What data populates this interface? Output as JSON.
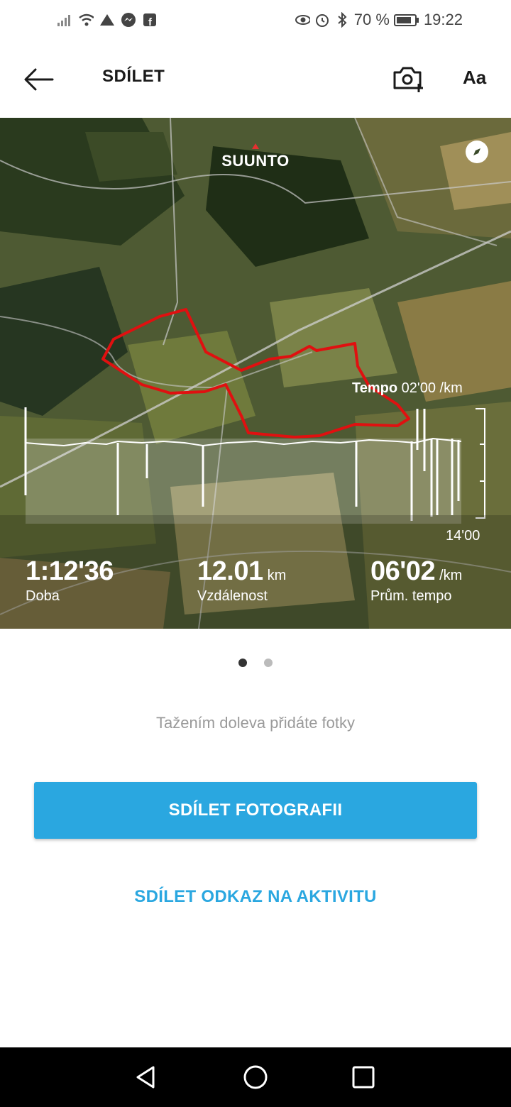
{
  "status_bar": {
    "icons_left": [
      "signal-icon",
      "wifi-icon",
      "mobile-data-icon",
      "messenger-icon",
      "facebook-icon"
    ],
    "icons_right": [
      "eye-comfort-icon",
      "alarm-icon",
      "bluetooth-icon"
    ],
    "battery": "70 %",
    "time": "19:22"
  },
  "header": {
    "title": "SDÍLET",
    "font_button": "Aa"
  },
  "map": {
    "brand": "SUUNTO",
    "tempo_label": "Tempo",
    "tempo_value": "02'00 /km",
    "tempo_max": "14'00",
    "route_color": "#e01010",
    "stats": [
      {
        "value": "1:12'36",
        "unit": "",
        "label": "Doba"
      },
      {
        "value": "12.01",
        "unit": "km",
        "label": "Vzdálenost"
      },
      {
        "value": "06'02",
        "unit": "/km",
        "label": "Prům. tempo"
      }
    ]
  },
  "pager": {
    "current": 1,
    "total": 2
  },
  "hint": "Tažením doleva přidáte fotky",
  "actions": {
    "share_photo": "SDÍLET FOTOGRAFII",
    "share_link": "SDÍLET ODKAZ NA AKTIVITU"
  },
  "colors": {
    "accent": "#2aa7e0"
  }
}
